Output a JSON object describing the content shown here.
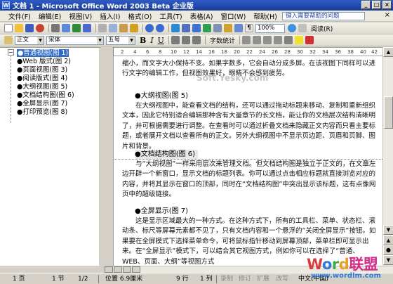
{
  "window": {
    "title": "文档 1 - Microsoft Office Word 2003 Beta 企业版"
  },
  "menu": {
    "items": [
      "文件(F)",
      "编辑(E)",
      "视图(V)",
      "插入(I)",
      "格式(O)",
      "工具(T)",
      "表格(A)",
      "窗口(W)",
      "帮助(H)"
    ],
    "help_placeholder": "键入需要帮助的问题"
  },
  "toolbar": {
    "zoom": "100%",
    "read_label": "阅读(R)",
    "style": "正文",
    "font": "宋体",
    "size": "五号",
    "bold": "B",
    "italic": "I",
    "underline": "U",
    "wordcount_label": "字数统计"
  },
  "document_map": {
    "items": [
      {
        "label": "●普通视图(图 1)",
        "selected": true
      },
      {
        "label": "●Web 版式(图 2)",
        "selected": false
      },
      {
        "label": "●页面视图(图 3)",
        "selected": false
      },
      {
        "label": "●阅读版式(图 4)",
        "selected": false
      },
      {
        "label": "●大纲视图(图 5)",
        "selected": false
      },
      {
        "label": "●文档结构图(图 6)",
        "selected": false
      },
      {
        "label": "●全屏显示(图 7)",
        "selected": false
      },
      {
        "label": "●打印预览(图 8)",
        "selected": false
      }
    ]
  },
  "ruler": {
    "ticks": [
      "2",
      "4",
      "6",
      "8",
      "10",
      "12",
      "14",
      "16",
      "18",
      "20",
      "22",
      "24",
      "26",
      "28",
      "30",
      "32",
      "34",
      "36",
      "38",
      "40",
      "42"
    ]
  },
  "document": {
    "watermark": "Soft.Yesky.com",
    "p1": "缩小，而文字大小保持不变。如果字数多，它会自动分成多屏。在该视图下同样可以进行文字的编辑工作，但视图效果好，眼睛不会感到疲劳。",
    "h5": "●大纲视图(图 5)",
    "p5": "在大纲视图中，能查看文档的结构，还可以通过拖动标题来移动、复制和重新组织文本，因此它特别适合编辑那种含有大量章节的长文档，能让你的文档层次结构清晰明了，并可根据需要进行调整。在查看时可以通过折叠文档来隐藏正文内容而只看主要标题，或者展开文档以查看所有的正文。另外大纲视图中不显示页边距、页眉和页脚、图片和背景。",
    "h6": "●文档结构图(图 6)",
    "p6": "与“大纲视图”一样采用层次来管理文档。但文档结构图是独立于正文的，在文章左边开辟一个新窗口，显示文档的标题列表。你可以通过点击相应标题就直接浏览对应的内容，并将其显示在窗口的顶部，同时在“文档结构图”中突出显示该标题，这有点像网页中的超级链接。",
    "h7": "●全屏显示(图 7)",
    "p7": "这是显示区域最大的一种方式。在这种方式下，所有的工具栏、菜单、状态栏、滚动条、标尺等屏幕元素都不见了，只有文档内容和一个悬浮的“关闭全屏显示”按钮。如果要在全屏模式下选择菜单命令，可将鼠标指针移动到屏幕顶部，菜单栏即可显示出来。在“全屏显示”模式下，可以结合其它视图方式，例如你可以在选择了“普通、WEB、页面、大纲”等视图方式"
  },
  "status": {
    "page": "1 页",
    "section": "1 节",
    "pages": "1/2",
    "position": "位置 6.9厘米",
    "line": "9 行",
    "column": "1 列",
    "rec": "录制",
    "trk": "修订",
    "ext": "扩展",
    "ovr": "改写",
    "lang": "中文(中国)"
  },
  "logo": {
    "main_w": "W",
    "main_o": "o",
    "main_r": "r",
    "main_d": "d",
    "main_cn": "联盟",
    "url": "www.wordlm.com"
  }
}
